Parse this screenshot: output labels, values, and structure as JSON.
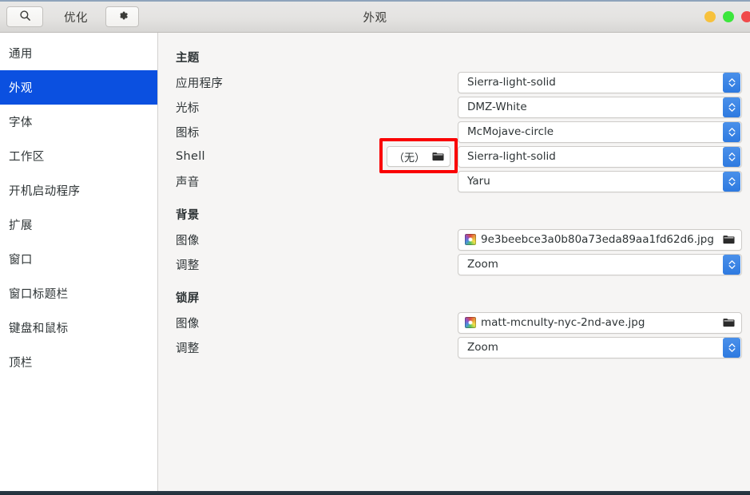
{
  "header": {
    "app_title": "优化",
    "window_title": "外观",
    "search_icon": "search-icon",
    "gear_icon": "gear-icon",
    "controls": [
      {
        "name": "minimize",
        "color": "#f7c13c"
      },
      {
        "name": "maximize",
        "color": "#3ce63c"
      },
      {
        "name": "close",
        "color": "#f04a4a"
      }
    ]
  },
  "sidebar": {
    "items": [
      {
        "label": "通用",
        "selected": false
      },
      {
        "label": "外观",
        "selected": true
      },
      {
        "label": "字体",
        "selected": false
      },
      {
        "label": "工作区",
        "selected": false
      },
      {
        "label": "开机启动程序",
        "selected": false
      },
      {
        "label": "扩展",
        "selected": false
      },
      {
        "label": "窗口",
        "selected": false
      },
      {
        "label": "窗口标题栏",
        "selected": false
      },
      {
        "label": "键盘和鼠标",
        "selected": false
      },
      {
        "label": "顶栏",
        "selected": false
      }
    ],
    "selected_color": "#0b50e0"
  },
  "main": {
    "sections": [
      {
        "title": "主题",
        "rows": [
          {
            "label": "应用程序",
            "value": "Sierra-light-solid",
            "control": "combo"
          },
          {
            "label": "光标",
            "value": "DMZ-White",
            "control": "combo"
          },
          {
            "label": "图标",
            "value": "McMojave-circle",
            "control": "combo"
          },
          {
            "label": "Shell",
            "value": "Sierra-light-solid",
            "control": "combo",
            "extra_button": {
              "label": "（无）",
              "icon": "folder-icon",
              "highlighted": true
            }
          },
          {
            "label": "声音",
            "value": "Yaru",
            "control": "combo"
          }
        ]
      },
      {
        "title": "背景",
        "rows": [
          {
            "label": "图像",
            "value": "9e3beebce3a0b80a73eda89aa1fd62d6.jpg",
            "control": "file",
            "icon": "folder-icon",
            "thumb": "image-thumbnail"
          },
          {
            "label": "调整",
            "value": "Zoom",
            "control": "combo"
          }
        ]
      },
      {
        "title": "锁屏",
        "rows": [
          {
            "label": "图像",
            "value": "matt-mcnulty-nyc-2nd-ave.jpg",
            "control": "file",
            "icon": "folder-icon",
            "thumb": "image-thumbnail"
          },
          {
            "label": "调整",
            "value": "Zoom",
            "control": "combo"
          }
        ]
      }
    ]
  },
  "highlight": {
    "color": "#fa0000"
  }
}
